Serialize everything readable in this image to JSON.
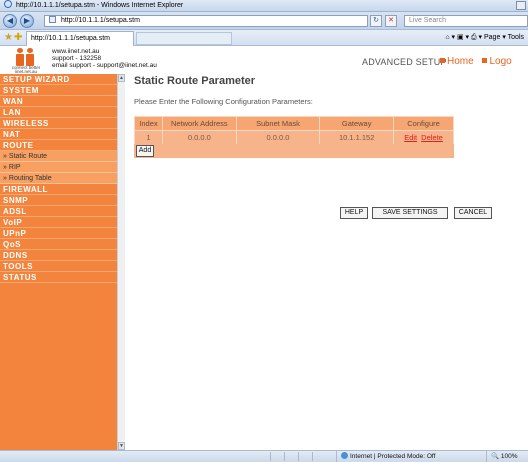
{
  "browser": {
    "title": "http://10.1.1.1/setupa.stm - Windows Internet Explorer",
    "address": "http://10.1.1.1/setupa.stm",
    "search_placeholder": "Live Search",
    "tab_label": "http://10.1.1.1/setupa.stm",
    "page_menu": "Page",
    "tools_menu": "Tools",
    "status_zone": "Internet | Protected Mode: Off",
    "zoom": "100%"
  },
  "header": {
    "site": "www.iinet.net.au",
    "support": "support - 132258",
    "email": "email support - support@iinet.net.au",
    "logo_tagline": "connect better",
    "logo_url": "iinet.net.au",
    "section": "ADVANCED SETUP",
    "home_link": "Home",
    "logout_link": "Logo"
  },
  "sidebar": {
    "items": [
      {
        "label": "SETUP WIZARD",
        "type": "main"
      },
      {
        "label": "SYSTEM",
        "type": "main"
      },
      {
        "label": "WAN",
        "type": "main"
      },
      {
        "label": "LAN",
        "type": "main"
      },
      {
        "label": "WIRELESS",
        "type": "main"
      },
      {
        "label": "NAT",
        "type": "main"
      },
      {
        "label": "ROUTE",
        "type": "main"
      },
      {
        "label": "Static Route",
        "type": "sub"
      },
      {
        "label": "RIP",
        "type": "sub"
      },
      {
        "label": "Routing Table",
        "type": "sub"
      },
      {
        "label": "FIREWALL",
        "type": "main"
      },
      {
        "label": "SNMP",
        "type": "main"
      },
      {
        "label": "ADSL",
        "type": "main"
      },
      {
        "label": "VoIP",
        "type": "main"
      },
      {
        "label": "UPnP",
        "type": "main"
      },
      {
        "label": "QoS",
        "type": "main"
      },
      {
        "label": "DDNS",
        "type": "main"
      },
      {
        "label": "TOOLS",
        "type": "main"
      },
      {
        "label": "STATUS",
        "type": "main"
      }
    ]
  },
  "main": {
    "title": "Static Route Parameter",
    "instruction": "Please Enter the Following Configuration Parameters:",
    "table": {
      "headers": [
        "Index",
        "Network Address",
        "Subnet Mask",
        "Gateway",
        "Configure"
      ],
      "rows": [
        {
          "index": "1",
          "network": "0.0.0.0",
          "mask": "0.0.0.0",
          "gateway": "10.1.1.152",
          "edit": "Edit",
          "delete": "Delete"
        }
      ]
    },
    "add_button": "Add",
    "help_button": "HELP",
    "save_button": "SAVE SETTINGS",
    "cancel_button": "CANCEL"
  },
  "colors": {
    "accent": "#f3843d",
    "table_header": "#f5a672",
    "table_row": "#f7b38a",
    "link_red": "#e02020"
  }
}
